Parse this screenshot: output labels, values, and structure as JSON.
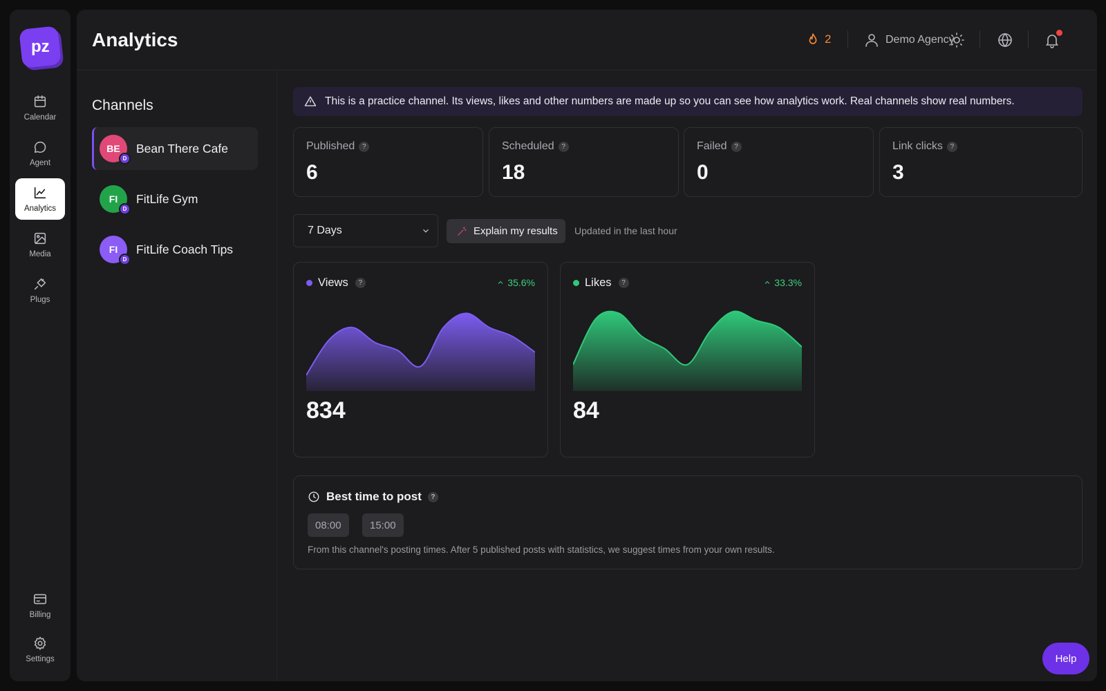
{
  "app": {
    "logo_text": "pz"
  },
  "nav": {
    "items": [
      {
        "label": "Calendar",
        "icon": "calendar-icon",
        "active": false
      },
      {
        "label": "Agent",
        "icon": "chat-bubble-icon",
        "active": false
      },
      {
        "label": "Analytics",
        "icon": "line-chart-icon",
        "active": true
      },
      {
        "label": "Media",
        "icon": "image-icon",
        "active": false
      },
      {
        "label": "Plugs",
        "icon": "plug-icon",
        "active": false
      }
    ],
    "bottom_items": [
      {
        "label": "Billing",
        "icon": "credit-card-icon"
      },
      {
        "label": "Settings",
        "icon": "gear-icon"
      }
    ]
  },
  "header": {
    "title": "Analytics",
    "streak_count": "2",
    "user_name": "Demo Agency",
    "icons": [
      "flame-icon",
      "user-icon",
      "sun-icon",
      "globe-icon",
      "bell-icon"
    ]
  },
  "channels": {
    "title": "Channels",
    "items": [
      {
        "initials": "BE",
        "name": "Bean There Cafe",
        "badge": "D",
        "color": "#e04878",
        "active": true
      },
      {
        "initials": "FI",
        "name": "FitLife Gym",
        "badge": "D",
        "color": "#22a34a",
        "active": false
      },
      {
        "initials": "FI",
        "name": "FitLife Coach Tips",
        "badge": "D",
        "color": "#8b5cf6",
        "active": false
      }
    ]
  },
  "banner": {
    "text": "This is a practice channel. Its views, likes and other numbers are made up so you can see how analytics work. Real channels show real numbers."
  },
  "stats": [
    {
      "label": "Published",
      "value": "6"
    },
    {
      "label": "Scheduled",
      "value": "18"
    },
    {
      "label": "Failed",
      "value": "0"
    },
    {
      "label": "Link clicks",
      "value": "3"
    }
  ],
  "help_glyph": "?",
  "controls": {
    "range_value": "7 Days",
    "explain_label": "Explain my results",
    "updated_text": "Updated in the last hour"
  },
  "chart_data": [
    {
      "type": "area",
      "series": [
        {
          "name": "Views",
          "values": [
            18,
            58,
            72,
            55,
            46,
            28,
            72,
            88,
            72,
            62,
            44
          ]
        }
      ],
      "total": "834",
      "change": "35.6%",
      "color": "#7c5cf0",
      "ylim": [
        0,
        100
      ]
    },
    {
      "type": "area",
      "series": [
        {
          "name": "Likes",
          "values": [
            30,
            82,
            88,
            62,
            48,
            30,
            68,
            90,
            80,
            72,
            50
          ]
        }
      ],
      "total": "84",
      "change": "33.3%",
      "color": "#2fc97a",
      "ylim": [
        0,
        100
      ]
    }
  ],
  "best_time": {
    "title": "Best time to post",
    "times": [
      "08:00",
      "15:00"
    ],
    "note": "From this channel's posting times. After 5 published posts with statistics, we suggest times from your own results."
  },
  "help_button": {
    "label": "Help"
  }
}
